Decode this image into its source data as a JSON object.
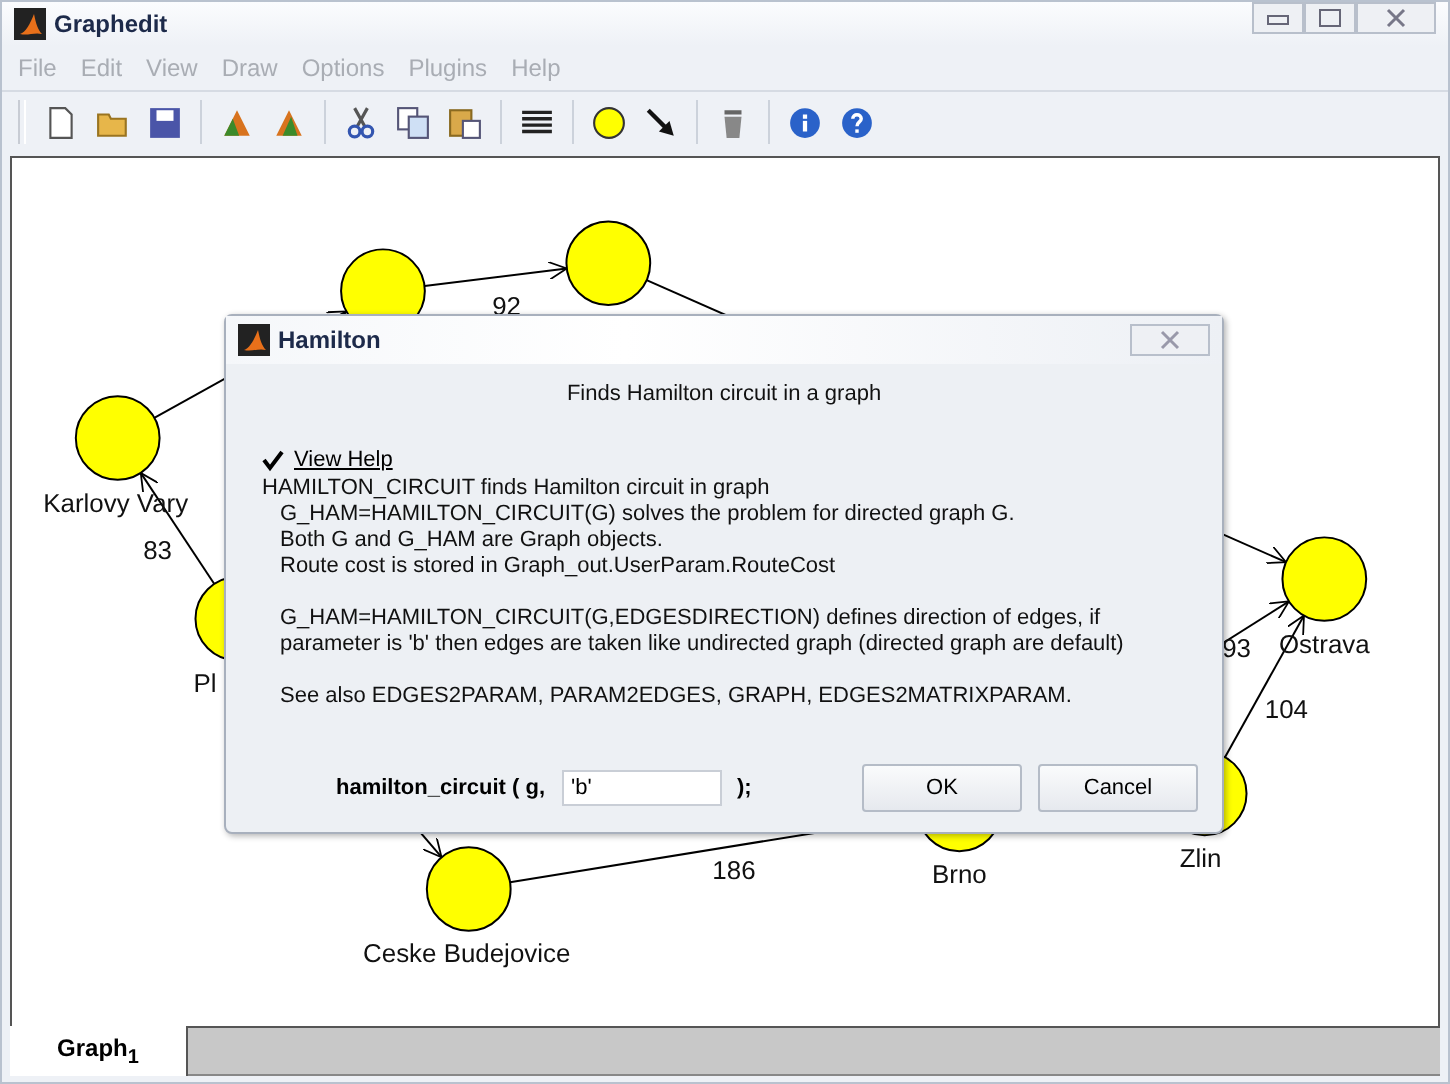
{
  "window": {
    "title": "Graphedit"
  },
  "menu": [
    "File",
    "Edit",
    "View",
    "Draw",
    "Options",
    "Plugins",
    "Help"
  ],
  "graph": {
    "node_labels": [
      "Karlovy Vary",
      "Pl",
      "Ostrava",
      "Zlin",
      "Ceske Budejovice",
      "Brno"
    ],
    "edge_weights": [
      "92",
      "83",
      "104",
      "186",
      "93"
    ]
  },
  "tabs": [
    {
      "label": "Graph$_{1}$",
      "selected": true
    }
  ],
  "dialog": {
    "title": "Hamilton",
    "description": "Finds Hamilton circuit in a graph",
    "checkbox": {
      "label": "View Help",
      "checked": true
    },
    "help": {
      "summary": "HAMILTON_CIRCUIT finds Hamilton circuit in graph",
      "paragraphs": [
        [
          "G_HAM=HAMILTON_CIRCUIT(G) solves the problem for directed graph G.",
          "Both G and G_HAM are Graph objects.",
          "Route cost is stored in Graph_out.UserParam.RouteCost"
        ],
        [
          "G_HAM=HAMILTON_CIRCUIT(G,EDGESDIRECTION) defines direction of edges, if",
          "parameter is 'b' then edges are taken like undirected graph (directed graph are default)"
        ],
        [
          "See also EDGES2PARAM, PARAM2EDGES, GRAPH, EDGES2MATRIXPARAM."
        ]
      ]
    },
    "call_prefix": "hamilton_circuit ( g,",
    "argument": "'b'",
    "call_suffix": ");",
    "buttons": [
      "OK",
      "Cancel"
    ]
  }
}
